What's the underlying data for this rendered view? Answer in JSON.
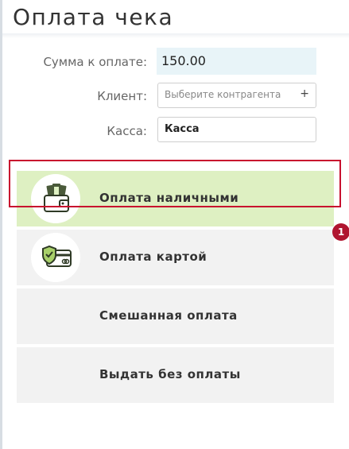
{
  "dialog": {
    "title": "Оплата чека"
  },
  "form": {
    "amount_label": "Сумма к оплате:",
    "amount_value": "150.00",
    "client_label": "Клиент:",
    "client_placeholder": "Выберите контрагента",
    "client_add": "+",
    "kassa_label": "Касса:",
    "kassa_value": "Касса"
  },
  "payment_options": [
    {
      "label": "Оплата наличными",
      "icon": "wallet-cash-icon"
    },
    {
      "label": "Оплата картой",
      "icon": "credit-card-shield-icon"
    },
    {
      "label": "Смешанная оплата",
      "icon": ""
    },
    {
      "label": "Выдать без оплаты",
      "icon": ""
    }
  ],
  "annotation": {
    "marker_number": "1"
  },
  "colors": {
    "cash_option_bg": "#def0c2",
    "option_bg": "#f2f2f2",
    "amount_bg": "#e8f4f8",
    "highlight_border": "#c8102e",
    "marker_bg": "#b0152f"
  }
}
